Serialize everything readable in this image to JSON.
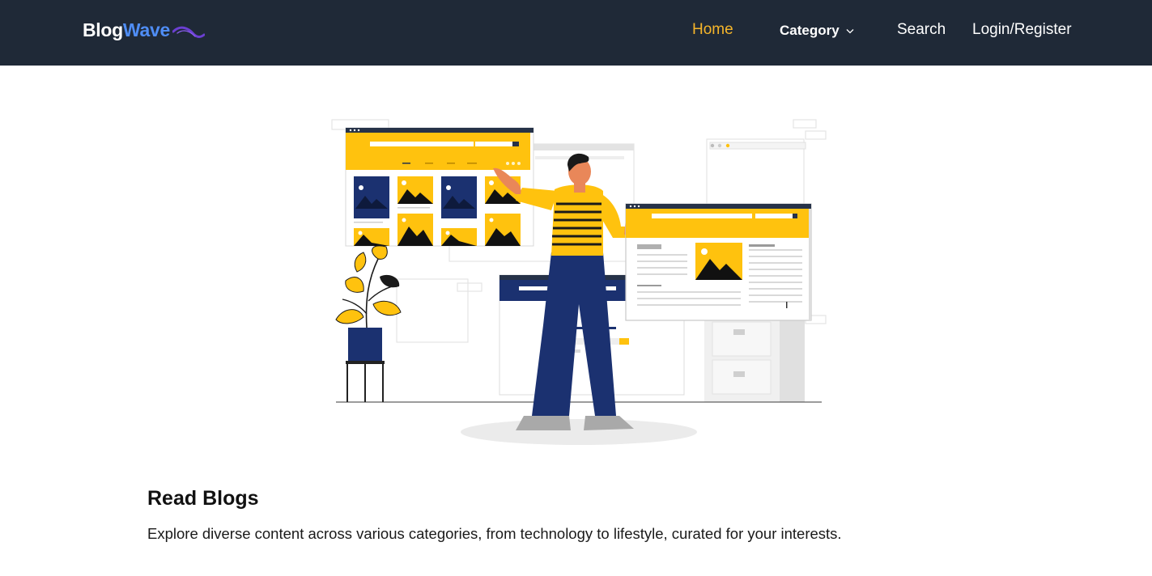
{
  "brand": {
    "logo_part1": "Blog",
    "logo_part2": "Wave"
  },
  "nav": {
    "home": "Home",
    "category": "Category",
    "search": "Search",
    "login_register": "Login/Register"
  },
  "colors": {
    "navbar_bg": "#1f2937",
    "active_link": "#f5b52a",
    "logo_accent": "#4f8df5",
    "illustration_yellow": "#ffc20e",
    "illustration_navy": "#1b3170"
  },
  "icons": {
    "category_dropdown": "chevron-down-icon",
    "logo_decoration": "wave-swoosh-icon"
  },
  "section": {
    "title": "Read Blogs",
    "description": "Explore diverse content across various categories, from technology to lifestyle, curated for your interests."
  }
}
